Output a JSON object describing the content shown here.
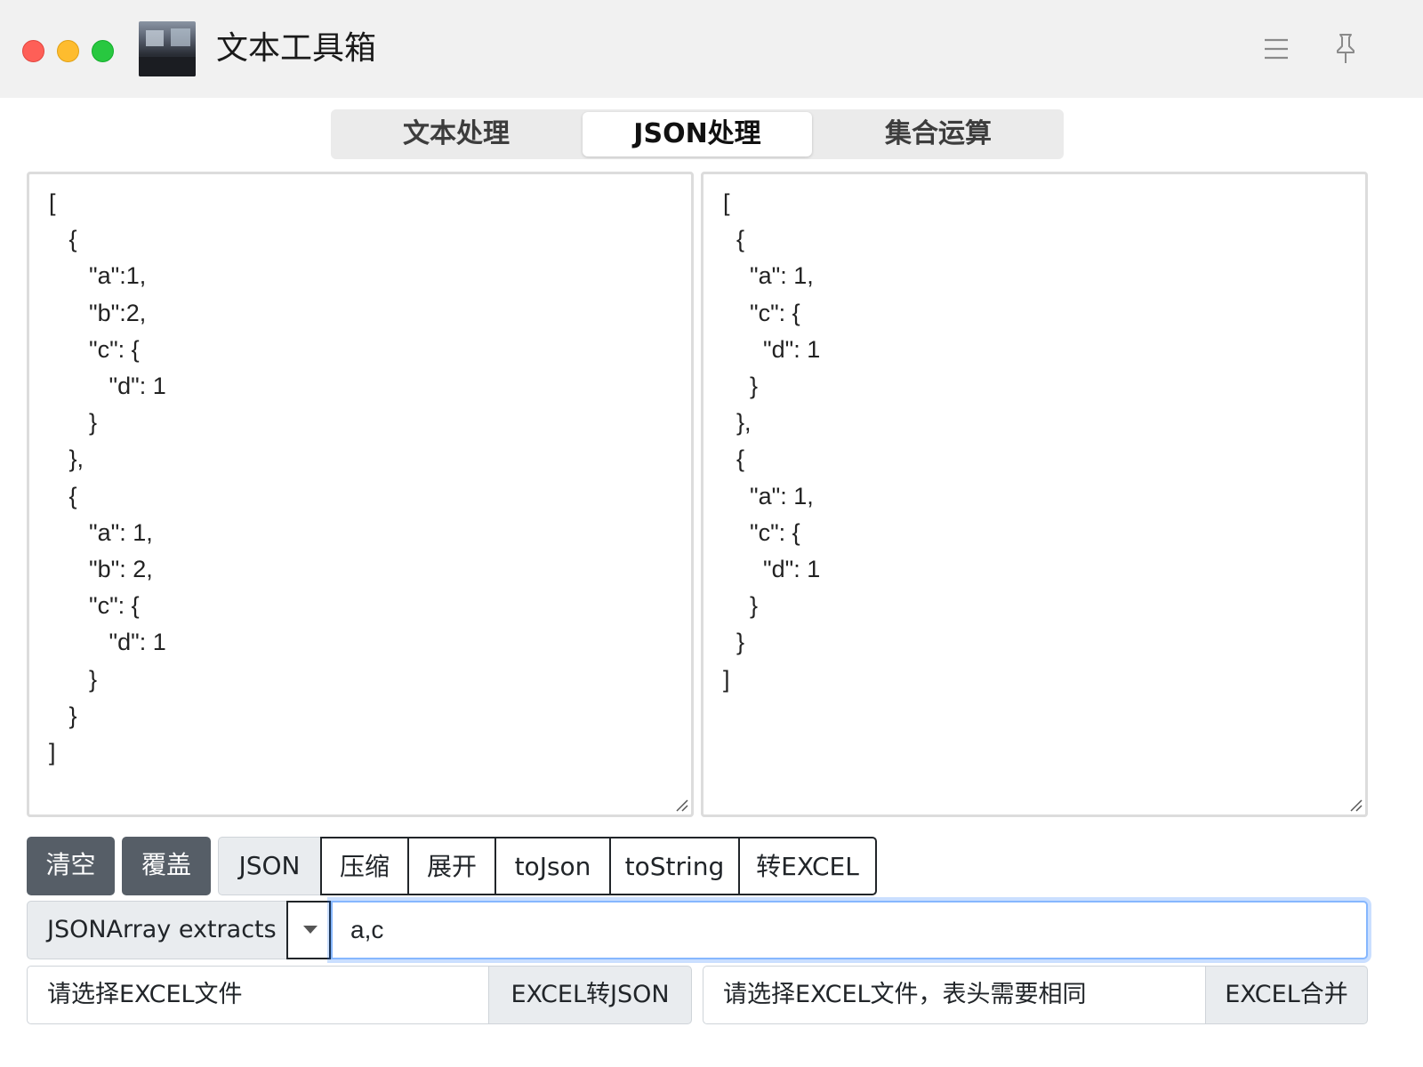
{
  "window": {
    "title": "文本工具箱"
  },
  "tabs": [
    {
      "label": "文本处理",
      "active": false
    },
    {
      "label": "JSON处理",
      "active": true
    },
    {
      "label": "集合运算",
      "active": false
    }
  ],
  "editors": {
    "left": "[\n   {\n      \"a\":1,\n      \"b\":2,\n      \"c\": {\n         \"d\": 1\n      }\n   },\n   {\n      \"a\": 1,\n      \"b\": 2,\n      \"c\": {\n         \"d\": 1\n      }\n   }\n]",
    "right": "[\n  {\n    \"a\": 1,\n    \"c\": {\n      \"d\": 1\n    }\n  },\n  {\n    \"a\": 1,\n    \"c\": {\n      \"d\": 1\n    }\n  }\n]"
  },
  "toolbar": {
    "clear_label": "清空",
    "overwrite_label": "覆盖",
    "json_label": "JSON",
    "compress_label": "压缩",
    "expand_label": "展开",
    "tojson_label": "toJson",
    "tostring_label": "toString",
    "toexcel_label": "转EXCEL"
  },
  "extract": {
    "mode": "JSONArray extracts",
    "value": "a,c"
  },
  "excel": {
    "file_placeholder": "请选择EXCEL文件",
    "to_json_label": "EXCEL转JSON",
    "merge_placeholder": "请选择EXCEL文件，表头需要相同",
    "merge_label": "EXCEL合并"
  }
}
